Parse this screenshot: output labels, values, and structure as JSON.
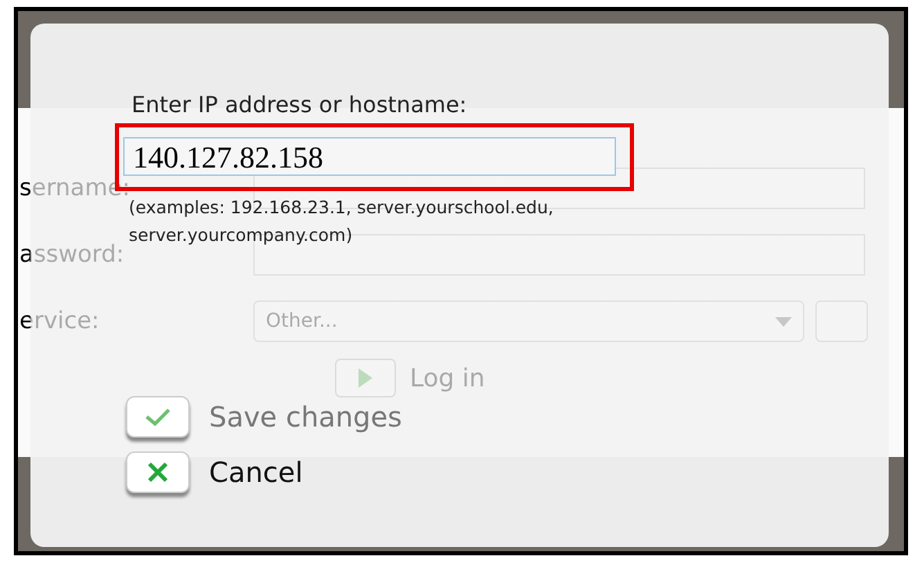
{
  "background_form": {
    "fields": [
      {
        "kind": "text",
        "label": "sername:"
      },
      {
        "kind": "text",
        "label": "assword:"
      },
      {
        "kind": "select",
        "label": "ervice:",
        "value": "Other..."
      }
    ],
    "login_button": "Log in"
  },
  "dialog": {
    "prompt": "Enter IP address or hostname:",
    "field": {
      "value": "140.127.82.158",
      "highlighted": true
    },
    "hint": "(examples: 192.168.23.1, server.yourschool.edu, server.yourcompany.com)",
    "buttons": [
      {
        "kind": "save",
        "label": "Save changes",
        "disabled": true
      },
      {
        "kind": "cancel",
        "label": "Cancel",
        "disabled": false
      }
    ]
  }
}
